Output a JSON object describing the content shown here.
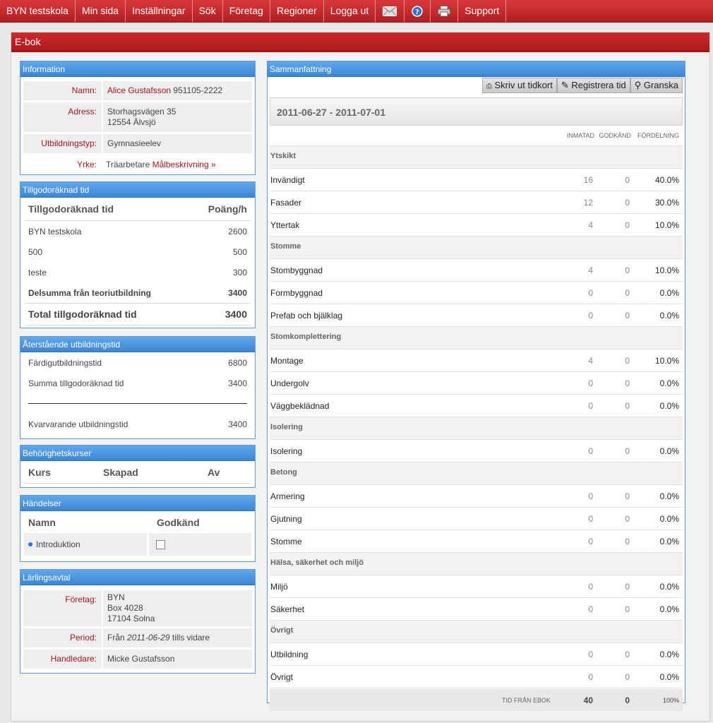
{
  "nav": {
    "items": [
      "BYN testskola",
      "Min sida",
      "Inställningar",
      "Sök",
      "Företag",
      "Regioner",
      "Logga ut"
    ],
    "support": "Support"
  },
  "page_title": "E-bok",
  "information": {
    "title": "Information",
    "name_label": "Namn:",
    "name": "Alice Gustafsson",
    "pnr": "951105-2222",
    "address_label": "Adress:",
    "address_line1": "Storhagsvägen 35",
    "address_line2": "12554 Älvsjö",
    "type_label": "Utbildningstyp:",
    "type": "Gymnasieelev",
    "job_label": "Yrke:",
    "job": "Träarbetare",
    "goal_link": "Målbeskrivning »"
  },
  "credited": {
    "title": "Tillgodoräknad tid",
    "col1": "Tillgodoräknad tid",
    "col2": "Poäng/h",
    "rows": [
      {
        "name": "BYN testskola",
        "value": "2600"
      },
      {
        "name": "500",
        "value": "500"
      },
      {
        "name": "teste",
        "value": "300"
      }
    ],
    "subtotal_label": "Delsumma från teoriutbildning",
    "subtotal": "3400",
    "total_label": "Total tillgodoräknad tid",
    "total": "3400"
  },
  "remaining": {
    "title": "Återstående utbildningstid",
    "r1_label": "Färdigutbildningstid",
    "r1": "6800",
    "r2_label": "Summa tillgodoräknad tid",
    "r2": "3400",
    "r3_label": "Kvarvarande utbildningstid",
    "r3": "3400"
  },
  "courses": {
    "title": "Behörighetskurser",
    "col1": "Kurs",
    "col2": "Skapad",
    "col3": "Av"
  },
  "events": {
    "title": "Händelser",
    "col1": "Namn",
    "col2": "Godkänd",
    "item": "Introduktion"
  },
  "apprentice": {
    "title": "Lärlingsavtal",
    "company_label": "Företag:",
    "company_line1": "BYN",
    "company_line2": "Box 4028",
    "company_line3": "17104 Solna",
    "period_label": "Period:",
    "period_prefix": "Från",
    "period_date": "2011-06-29",
    "period_suffix": "tills vidare",
    "supervisor_label": "Handledare:",
    "supervisor": "Micke Gustafsson"
  },
  "summary": {
    "title": "Sammanfattning",
    "btn_print": "Skriv ut tidkort",
    "btn_register": "Registrera tid",
    "btn_review": "Granska",
    "period": "2011-06-27 - 2011-07-01",
    "h1": "INMATAD",
    "h2": "GODKÄND",
    "h3": "FÖRDELNING",
    "groups": [
      {
        "name": "Ytskikt",
        "rows": [
          {
            "n": "Invändigt",
            "a": "16",
            "b": "0",
            "c": "40.0%"
          },
          {
            "n": "Fasader",
            "a": "12",
            "b": "0",
            "c": "30.0%"
          },
          {
            "n": "Yttertak",
            "a": "4",
            "b": "0",
            "c": "10.0%"
          }
        ]
      },
      {
        "name": "Stomme",
        "rows": [
          {
            "n": "Stombyggnad",
            "a": "4",
            "b": "0",
            "c": "10.0%"
          },
          {
            "n": "Formbyggnad",
            "a": "0",
            "b": "0",
            "c": "0.0%"
          },
          {
            "n": "Prefab och bjälklag",
            "a": "0",
            "b": "0",
            "c": "0.0%"
          }
        ]
      },
      {
        "name": "Stomkomplettering",
        "rows": [
          {
            "n": "Montage",
            "a": "4",
            "b": "0",
            "c": "10.0%"
          },
          {
            "n": "Undergolv",
            "a": "0",
            "b": "0",
            "c": "0.0%"
          },
          {
            "n": "Väggbeklädnad",
            "a": "0",
            "b": "0",
            "c": "0.0%"
          }
        ]
      },
      {
        "name": "Isolering",
        "rows": [
          {
            "n": "Isolering",
            "a": "0",
            "b": "0",
            "c": "0.0%"
          }
        ]
      },
      {
        "name": "Betong",
        "rows": [
          {
            "n": "Armering",
            "a": "0",
            "b": "0",
            "c": "0.0%"
          },
          {
            "n": "Gjutning",
            "a": "0",
            "b": "0",
            "c": "0.0%"
          },
          {
            "n": "Stomme",
            "a": "0",
            "b": "0",
            "c": "0.0%"
          }
        ]
      },
      {
        "name": "Hälsa, säkerhet och miljö",
        "rows": [
          {
            "n": "Miljö",
            "a": "0",
            "b": "0",
            "c": "0.0%"
          },
          {
            "n": "Säkerhet",
            "a": "0",
            "b": "0",
            "c": "0.0%"
          }
        ]
      },
      {
        "name": "Övrigt",
        "rows": [
          {
            "n": "Utbildning",
            "a": "0",
            "b": "0",
            "c": "0.0%"
          },
          {
            "n": "Övrigt",
            "a": "0",
            "b": "0",
            "c": "0.0%"
          }
        ]
      }
    ],
    "footer_label": "TID FRÅN EBOK",
    "footer_a": "40",
    "footer_b": "0",
    "footer_c": "100%"
  }
}
